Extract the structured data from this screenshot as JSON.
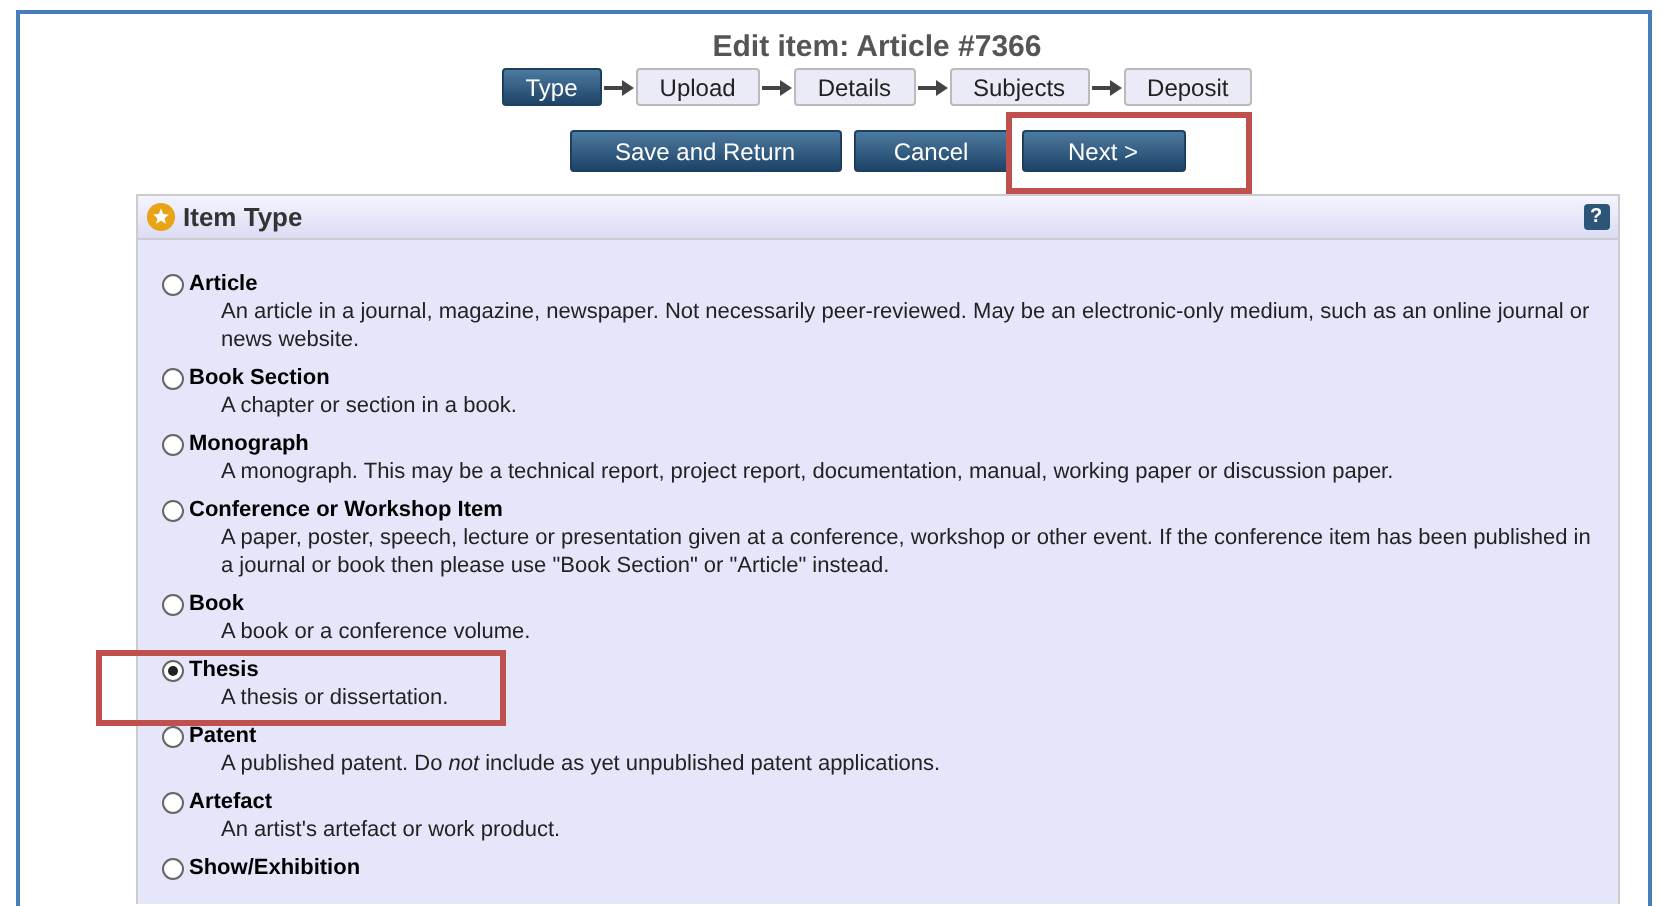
{
  "page_title": "Edit item: Article #7366",
  "steps": [
    {
      "label": "Type",
      "selected": true
    },
    {
      "label": "Upload",
      "selected": false
    },
    {
      "label": "Details",
      "selected": false
    },
    {
      "label": "Subjects",
      "selected": false
    },
    {
      "label": "Deposit",
      "selected": false
    }
  ],
  "buttons": [
    "Save and Return",
    "Cancel",
    "Next >"
  ],
  "panel": {
    "title": "Item Type",
    "help": "?"
  },
  "item_types": [
    {
      "label": "Article",
      "description": "An article in a journal, magazine, newspaper. Not necessarily peer-reviewed. May be an electronic-only medium, such as an online journal or news website.",
      "selected": false
    },
    {
      "label": "Book Section",
      "description": "A chapter or section in a book.",
      "selected": false
    },
    {
      "label": "Monograph",
      "description": "A monograph. This may be a technical report, project report, documentation, manual, working paper or discussion paper.",
      "selected": false
    },
    {
      "label": "Conference or Workshop Item",
      "description": "A paper, poster, speech, lecture or presentation given at a conference, workshop or other event. If the conference item has been published in a journal or book then please use \"Book Section\" or \"Article\" instead.",
      "selected": false
    },
    {
      "label": "Book",
      "description": "A book or a conference volume.",
      "selected": false
    },
    {
      "label": "Thesis",
      "description": "A thesis or dissertation.",
      "selected": true
    },
    {
      "label": "Patent",
      "description": "A published patent. Do *not* include as yet unpublished patent applications.",
      "selected": false
    },
    {
      "label": "Artefact",
      "description": "An artist's artefact or work product.",
      "selected": false
    },
    {
      "label": "Show/Exhibition",
      "selected": false
    }
  ]
}
